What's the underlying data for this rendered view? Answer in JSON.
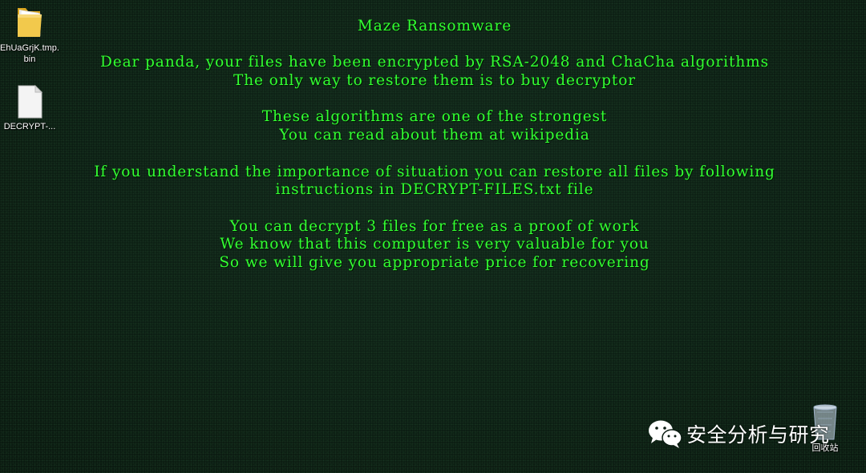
{
  "desktop": {
    "icons": [
      {
        "label": "EhUaGrjK.tmp.bin",
        "icon": "folder-icon"
      },
      {
        "label": "DECRYPT-...",
        "icon": "text-file-icon"
      },
      {
        "label": "回收站",
        "icon": "recycle-bin-icon"
      }
    ]
  },
  "note": {
    "title": "Maze Ransomware",
    "paragraphs": [
      [
        "Dear panda, your files have been encrypted by RSA-2048 and ChaCha algorithms",
        "The only way to restore them is to buy decryptor"
      ],
      [
        "These algorithms are one of the strongest",
        "You can read about them at wikipedia"
      ],
      [
        "If you understand the importance of situation you can restore all files by following",
        "instructions in DECRYPT-FILES.txt file"
      ],
      [
        "You can decrypt 3 files for free as a proof of work",
        "We know that this computer is very valuable for you",
        "So we will give you appropriate price for recovering"
      ]
    ],
    "text_color": "#33ff33"
  },
  "watermark": {
    "text": "安全分析与研究",
    "logo": "wechat-logo-icon"
  }
}
